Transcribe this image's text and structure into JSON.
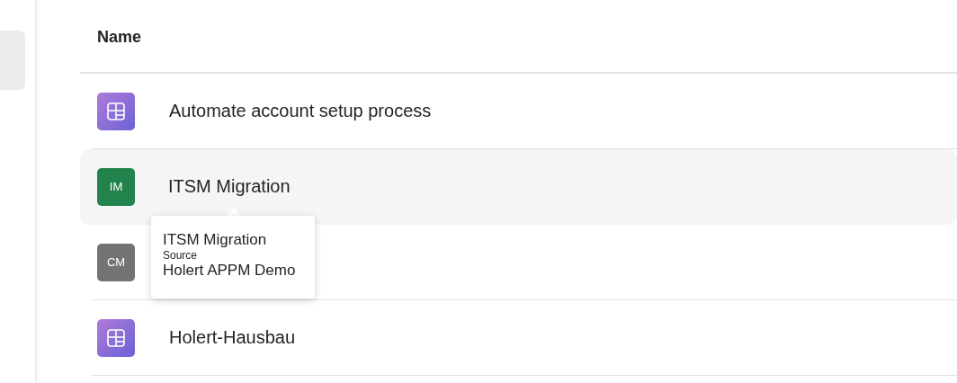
{
  "table": {
    "columns": [
      "Name"
    ],
    "rows": [
      {
        "kind": "app",
        "name": "Automate account setup process",
        "selected": false
      },
      {
        "kind": "initials",
        "initials": "IM",
        "color": "#22834c",
        "name": "ITSM Migration",
        "selected": true
      },
      {
        "kind": "initials",
        "initials": "CM",
        "color": "#737373",
        "selected": false
      },
      {
        "kind": "app",
        "name": "Holert-Hausbau",
        "selected": false
      }
    ]
  },
  "tooltip": {
    "title": "ITSM Migration",
    "label": "Source",
    "value": "Holert APPM Demo"
  }
}
